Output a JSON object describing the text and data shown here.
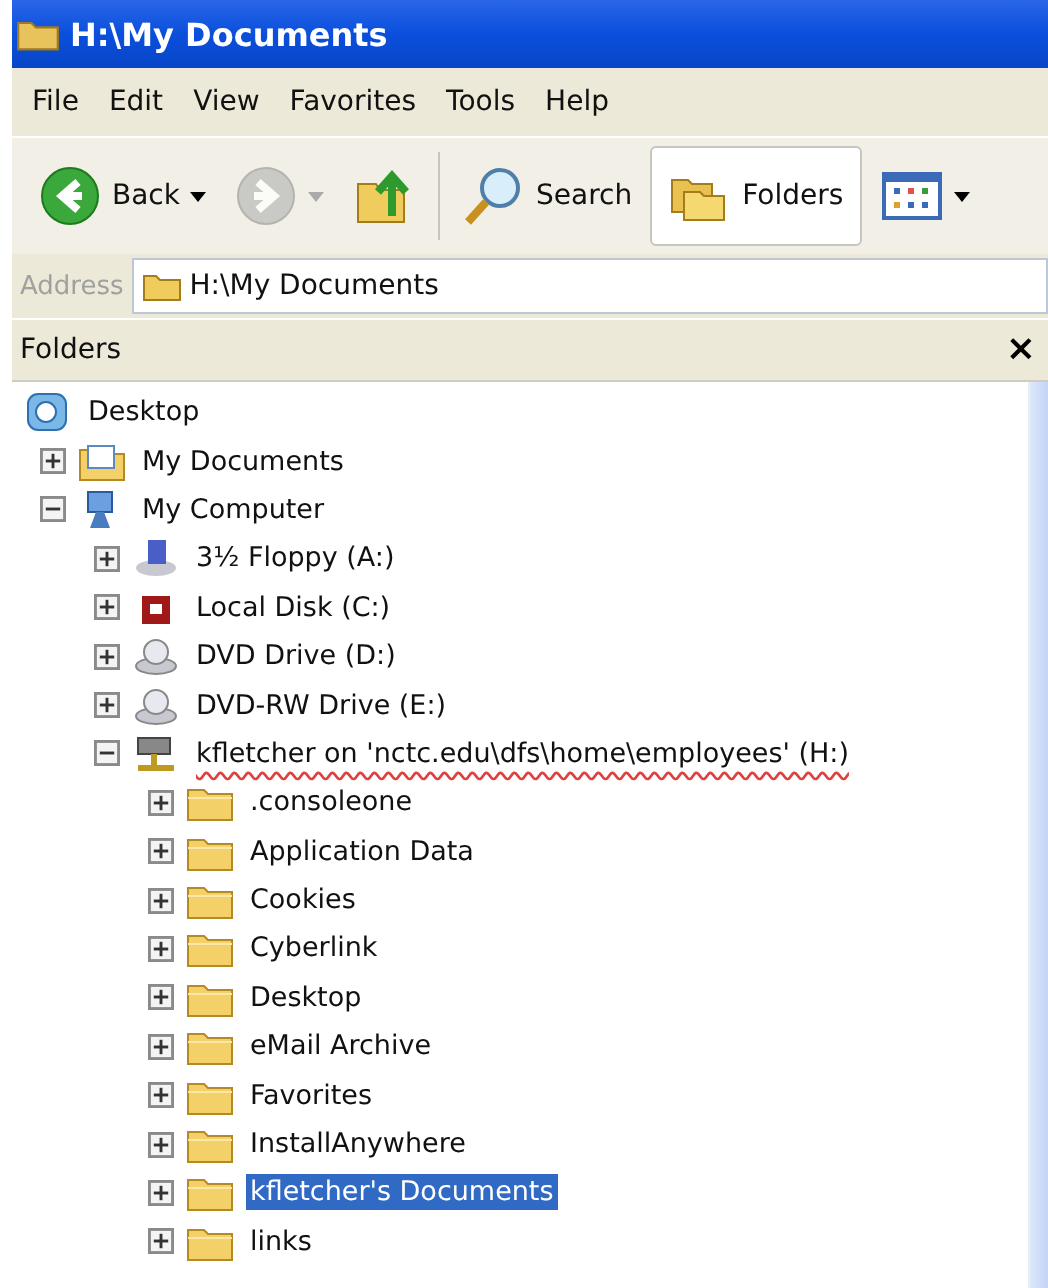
{
  "window": {
    "title": "H:\\My Documents"
  },
  "menu": [
    "File",
    "Edit",
    "View",
    "Favorites",
    "Tools",
    "Help"
  ],
  "toolbar": [
    {
      "kind": "back",
      "label": "Back",
      "dropdown": true,
      "disabled": false,
      "pressed": false
    },
    {
      "kind": "forward",
      "dropdown": true,
      "disabled": true,
      "pressed": false
    },
    {
      "kind": "up",
      "dropdown": false,
      "disabled": false,
      "pressed": false
    },
    {
      "kind": "search",
      "label": "Search",
      "dropdown": false,
      "disabled": false,
      "pressed": false
    },
    {
      "kind": "folders",
      "label": "Folders",
      "dropdown": false,
      "disabled": false,
      "pressed": true
    },
    {
      "kind": "views",
      "dropdown": true,
      "disabled": false,
      "pressed": false
    }
  ],
  "address": {
    "label": "Address",
    "value": "H:\\My Documents"
  },
  "folders_pane": {
    "title": "Folders",
    "close": "×"
  },
  "tree": [
    {
      "label": "Desktop",
      "kind": "desktop",
      "selected": false,
      "underlined": false,
      "children": [
        {
          "label": "My Documents",
          "kind": "documents",
          "expanded": false,
          "selected": false,
          "underlined": false
        },
        {
          "label": "My Computer",
          "kind": "computer",
          "expanded": true,
          "selected": false,
          "underlined": false,
          "children": [
            {
              "label": "3½ Floppy (A:)",
              "kind": "floppy",
              "expanded": false,
              "selected": false,
              "underlined": false
            },
            {
              "label": "Local Disk (C:)",
              "kind": "disk",
              "expanded": false,
              "selected": false,
              "underlined": false
            },
            {
              "label": "DVD Drive (D:)",
              "kind": "dvd",
              "expanded": false,
              "selected": false,
              "underlined": false
            },
            {
              "label": "DVD-RW Drive (E:)",
              "kind": "dvd",
              "expanded": false,
              "selected": false,
              "underlined": false
            },
            {
              "label": "kfletcher on 'nctc.edu\\dfs\\home\\employees' (H:)",
              "kind": "network",
              "expanded": true,
              "selected": false,
              "underlined": true,
              "children": [
                {
                  "label": ".consoleone",
                  "kind": "folder",
                  "expanded": false,
                  "selected": false,
                  "underlined": false
                },
                {
                  "label": "Application Data",
                  "kind": "folder",
                  "expanded": false,
                  "selected": false,
                  "underlined": false
                },
                {
                  "label": "Cookies",
                  "kind": "folder",
                  "expanded": false,
                  "selected": false,
                  "underlined": false
                },
                {
                  "label": "Cyberlink",
                  "kind": "folder",
                  "expanded": false,
                  "selected": false,
                  "underlined": false
                },
                {
                  "label": "Desktop",
                  "kind": "folder",
                  "expanded": false,
                  "selected": false,
                  "underlined": false
                },
                {
                  "label": "eMail Archive",
                  "kind": "folder",
                  "expanded": false,
                  "selected": false,
                  "underlined": false
                },
                {
                  "label": "Favorites",
                  "kind": "folder",
                  "expanded": false,
                  "selected": false,
                  "underlined": false
                },
                {
                  "label": "InstallAnywhere",
                  "kind": "folder",
                  "expanded": false,
                  "selected": false,
                  "underlined": false
                },
                {
                  "label": "kfletcher's Documents",
                  "kind": "folder",
                  "expanded": false,
                  "selected": true,
                  "underlined": false
                },
                {
                  "label": "links",
                  "kind": "folder",
                  "expanded": false,
                  "selected": false,
                  "underlined": false
                }
              ]
            }
          ]
        }
      ]
    }
  ]
}
